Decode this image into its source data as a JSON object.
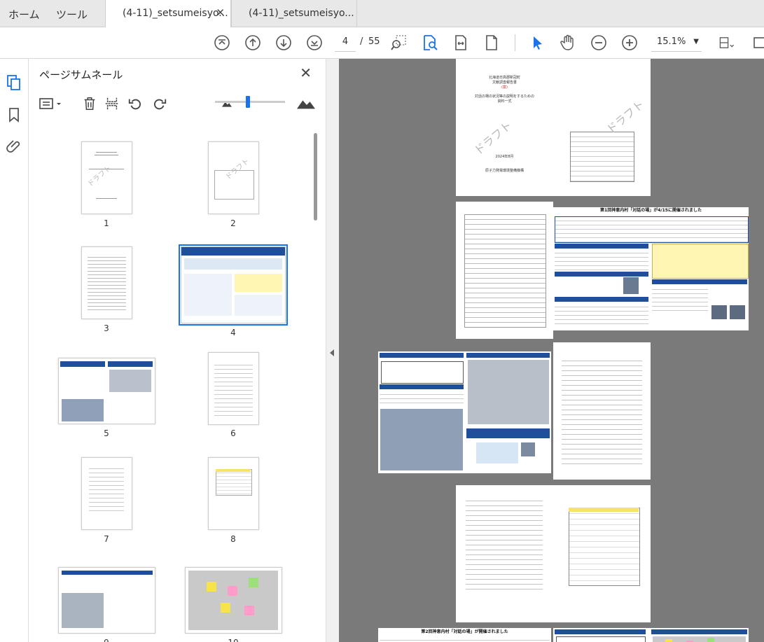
{
  "tabs": {
    "home": "ホーム",
    "tools": "ツール",
    "doc1": "(4-11)_setsumeisyo...",
    "doc2": "(4-11)_setsumeisyo..."
  },
  "toolbar": {
    "current_page": "4",
    "page_count": "55",
    "zoom": "15.1%",
    "icons": [
      "first-page-icon",
      "prev-page-icon",
      "next-page-icon",
      "last-page-icon",
      "marquee-zoom-icon",
      "find-text-icon",
      "fit-width-icon",
      "fit-page-icon",
      "select-cursor-icon",
      "hand-tool-icon",
      "zoom-out-icon",
      "zoom-in-icon",
      "page-layout-icon",
      "more-tools-icon"
    ]
  },
  "panel": {
    "title": "ページサムネール",
    "thumbnails": [
      "1",
      "2",
      "3",
      "4",
      "5",
      "6",
      "7",
      "8",
      "9",
      "10"
    ],
    "selected": "4"
  },
  "document": {
    "p1_lines": [
      "北海道日高郡新冠町",
      "文献調査報告書",
      "(案)",
      "対話の場の状況等の説明をするための",
      "資料一式"
    ],
    "p1_date": "2024年8月",
    "p1_org": "原子力発電環境整備機構",
    "watermark": "ドラフト",
    "p4_title": "第1回神恵内村「対話の場」が4/15に開催されました",
    "p9_title": "第2回神恵内村「対話の場」が開催されました"
  },
  "colors": {
    "accent": "#1a73e8",
    "banner_blue": "#1f4e9a",
    "note_yellow": "#fff6b3",
    "viewer_bg": "#7a7a7a"
  }
}
